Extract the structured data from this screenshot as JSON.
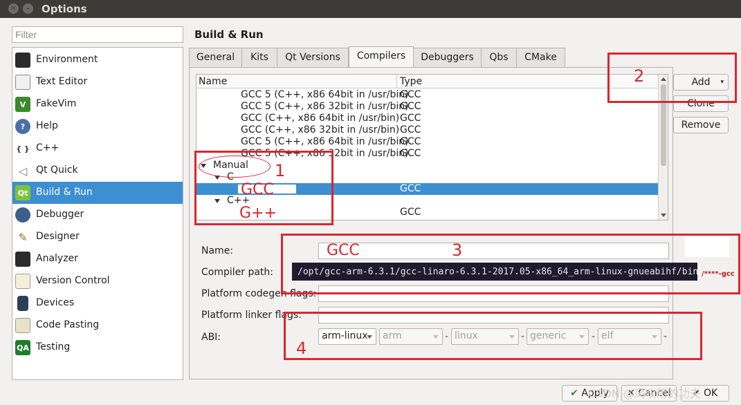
{
  "window": {
    "title": "Options"
  },
  "filter": {
    "placeholder": "Filter"
  },
  "categories": [
    {
      "label": "Environment",
      "icon": "monitor-icon"
    },
    {
      "label": "Text Editor",
      "icon": "text-editor-icon"
    },
    {
      "label": "FakeVim",
      "icon": "fakevim-icon"
    },
    {
      "label": "Help",
      "icon": "help-icon"
    },
    {
      "label": "C++",
      "icon": "cpp-braces-icon"
    },
    {
      "label": "Qt Quick",
      "icon": "qt-quick-icon"
    },
    {
      "label": "Build & Run",
      "icon": "build-run-icon",
      "selected": true
    },
    {
      "label": "Debugger",
      "icon": "debugger-icon"
    },
    {
      "label": "Designer",
      "icon": "designer-icon"
    },
    {
      "label": "Analyzer",
      "icon": "analyzer-icon"
    },
    {
      "label": "Version Control",
      "icon": "version-control-icon"
    },
    {
      "label": "Devices",
      "icon": "devices-icon"
    },
    {
      "label": "Code Pasting",
      "icon": "code-pasting-icon"
    },
    {
      "label": "Testing",
      "icon": "testing-icon"
    }
  ],
  "page_title": "Build & Run",
  "tabs": [
    "General",
    "Kits",
    "Qt Versions",
    "Compilers",
    "Debuggers",
    "Qbs",
    "CMake"
  ],
  "active_tab": "Compilers",
  "tree": {
    "headers": {
      "name": "Name",
      "type": "Type"
    },
    "auto_rows": [
      {
        "name": "GCC 5 (C++, x86 64bit in /usr/bin)",
        "type": "GCC"
      },
      {
        "name": "GCC 5 (C++, x86 32bit in /usr/bin)",
        "type": "GCC"
      },
      {
        "name": "GCC (C++, x86 64bit in /usr/bin)",
        "type": "GCC"
      },
      {
        "name": "GCC (C++, x86 32bit in /usr/bin)",
        "type": "GCC"
      },
      {
        "name": "GCC 5 (C++, x86 64bit in /usr/bin)",
        "type": "GCC"
      },
      {
        "name": "GCC 5 (C++, x86 32bit in /usr/bin)",
        "type": "GCC"
      }
    ],
    "manual": "Manual",
    "c_group": "C",
    "c_row_type": "GCC",
    "cpp_group": "C++",
    "cpp_row_type": "GCC"
  },
  "buttons": {
    "add": "Add",
    "clone": "Clone",
    "remove": "Remove"
  },
  "form": {
    "name_label": "Name:",
    "name_value": "GCC",
    "path_label": "Compiler path:",
    "path_value": "/opt/gcc-arm-6.3.1/gcc-linaro-6.3.1-2017.05-x86_64_arm-linux-gnueabihf/bin",
    "codegen_label": "Platform codegen flags:",
    "linker_label": "Platform linker flags:",
    "abi_label": "ABI:",
    "abi": [
      "arm-linux",
      "arm",
      "linux",
      "generic",
      "elf"
    ]
  },
  "bottom": {
    "apply": "Apply",
    "cancel": "Cancel",
    "ok": "OK"
  },
  "annotations": {
    "n1": "1",
    "n2": "2",
    "n3": "3",
    "n4": "4",
    "gcc": "GCC",
    "gpp": "G++",
    "gcc_name": "GCC",
    "suffix": "/****-gcc"
  },
  "watermark": "CSDN @风吹雨的功夫",
  "colors": {
    "selection": "#3d8fd1",
    "annotation": "#d9262e"
  }
}
